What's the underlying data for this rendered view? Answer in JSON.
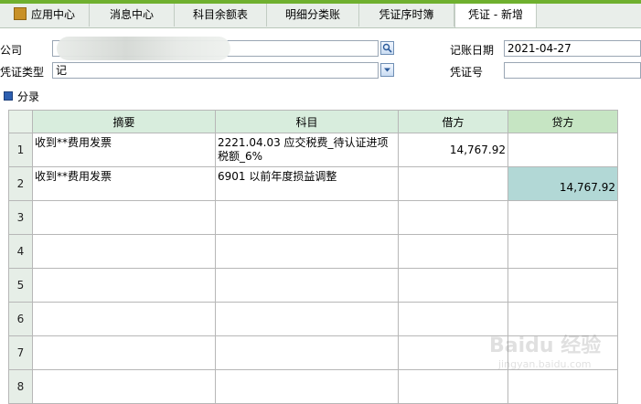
{
  "tabs": [
    {
      "label": "应用中心"
    },
    {
      "label": "消息中心"
    },
    {
      "label": "科目余额表"
    },
    {
      "label": "明细分类账"
    },
    {
      "label": "凭证序时簿"
    },
    {
      "label": "凭证 - 新增"
    }
  ],
  "form": {
    "company_label": "公司",
    "company_value": "",
    "voucher_type_label": "凭证类型",
    "voucher_type_value": "记",
    "date_label": "记账日期",
    "date_value": "2021-04-27",
    "voucher_no_label": "凭证号",
    "voucher_no_value": ""
  },
  "section_title": "分录",
  "columns": {
    "summary": "摘要",
    "account": "科目",
    "debit": "借方",
    "credit": "贷方"
  },
  "rows": [
    {
      "num": "1",
      "summary": "收到**费用发票",
      "account": "2221.04.03 应交税费_待认证进项税额_6%",
      "debit": "14,767.92",
      "credit": ""
    },
    {
      "num": "2",
      "summary": "收到**费用发票",
      "account": "6901 以前年度损益调整",
      "debit": "",
      "credit": "14,767.92"
    },
    {
      "num": "3",
      "summary": "",
      "account": "",
      "debit": "",
      "credit": ""
    },
    {
      "num": "4",
      "summary": "",
      "account": "",
      "debit": "",
      "credit": ""
    },
    {
      "num": "5",
      "summary": "",
      "account": "",
      "debit": "",
      "credit": ""
    },
    {
      "num": "6",
      "summary": "",
      "account": "",
      "debit": "",
      "credit": ""
    },
    {
      "num": "7",
      "summary": "",
      "account": "",
      "debit": "",
      "credit": ""
    },
    {
      "num": "8",
      "summary": "",
      "account": "",
      "debit": "",
      "credit": ""
    }
  ],
  "watermark": {
    "brand": "Baidu 经验",
    "sub": "jingyan.baidu.com"
  },
  "icons": {
    "tab_app_center": "app-center-icon",
    "company_lookup": "search-icon",
    "voucher_type_dropdown": "chevron-down-icon",
    "section": "square-bullet-icon"
  },
  "colors": {
    "accent": "#6fb02f",
    "header": "#d8eddd",
    "selected_cell": "#b2d8d6"
  }
}
